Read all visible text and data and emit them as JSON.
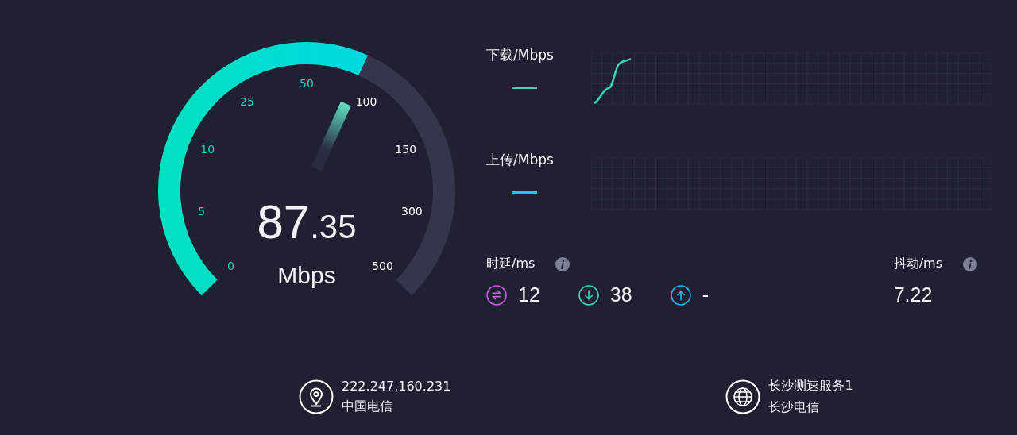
{
  "gauge": {
    "ticks": [
      "0",
      "5",
      "10",
      "25",
      "50",
      "100",
      "150",
      "300",
      "500"
    ],
    "value": "87.35",
    "unit": "Mbps"
  },
  "charts": [
    {
      "label": "下载/Mbps",
      "color": "#3ed6b0",
      "kind": "line"
    },
    {
      "label": "上传/Mbps",
      "color": "#1ec8e8",
      "kind": "empty"
    }
  ],
  "latency": {
    "label": "时延/ms",
    "items": [
      {
        "kind": "ping",
        "value": "12"
      },
      {
        "kind": "download",
        "value": "38"
      },
      {
        "kind": "upload",
        "value": "-"
      }
    ]
  },
  "jitter": {
    "label": "抖动/ms",
    "value": "7.22"
  },
  "client": {
    "ip": "222.247.160.231",
    "isp": "中国电信"
  },
  "server": {
    "name": "长沙测速服务1",
    "isp": "长沙电信"
  }
}
